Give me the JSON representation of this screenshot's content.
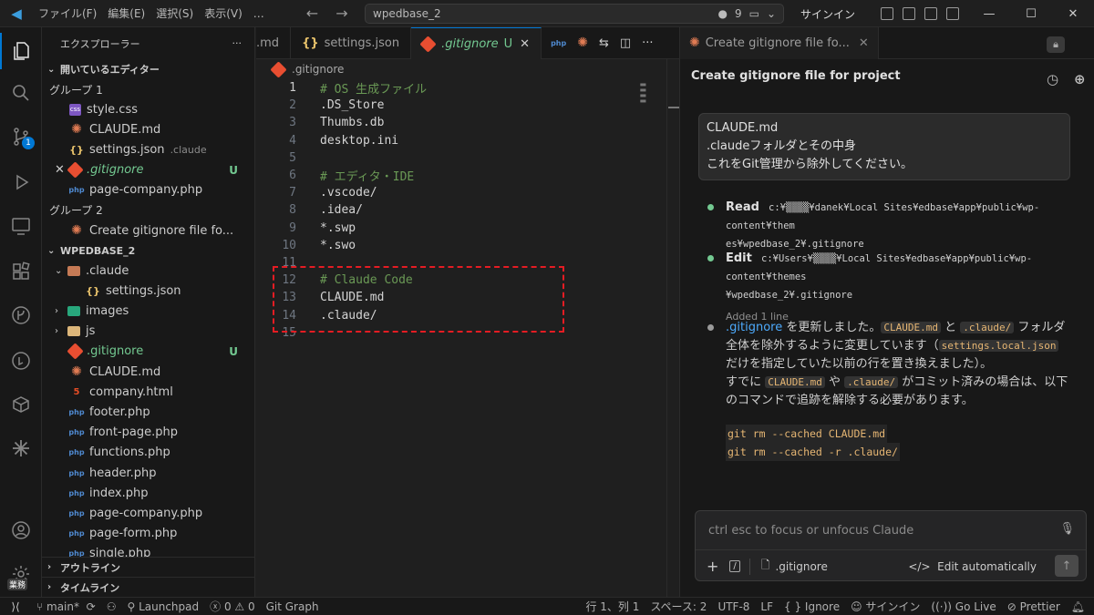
{
  "titlebar": {
    "menu": [
      "ファイル(F)",
      "編集(E)",
      "選択(S)",
      "表示(V)",
      "…"
    ],
    "search_text": "wpedbase_2",
    "count": "9",
    "signin": "サインイン"
  },
  "sidebar": {
    "title": "エクスプローラー",
    "open_editors_title": "開いているエディター",
    "group1_label": "グループ 1",
    "group2_label": "グループ 2",
    "open_editors": [
      {
        "name": "style.css"
      },
      {
        "name": "CLAUDE.md"
      },
      {
        "name": "settings.json",
        "desc": ".claude"
      },
      {
        "name": ".gitignore",
        "status": "U"
      },
      {
        "name": "page-company.php"
      }
    ],
    "group2_items": [
      {
        "name": "Create gitignore file fo..."
      }
    ],
    "project_title": "WPEDBASE_2",
    "tree": [
      {
        "name": ".claude"
      },
      {
        "name": "settings.json"
      },
      {
        "name": "images"
      },
      {
        "name": "js"
      },
      {
        "name": ".gitignore",
        "status": "U"
      },
      {
        "name": "CLAUDE.md"
      },
      {
        "name": "company.html"
      },
      {
        "name": "footer.php"
      },
      {
        "name": "front-page.php"
      },
      {
        "name": "functions.php"
      },
      {
        "name": "header.php"
      },
      {
        "name": "index.php"
      },
      {
        "name": "page-company.php"
      },
      {
        "name": "page-form.php"
      },
      {
        "name": "single.php"
      }
    ],
    "outline_title": "アウトライン",
    "timeline_title": "タイムライン",
    "activity_badge": "1",
    "account_badge": "業務"
  },
  "editor": {
    "tabs": [
      {
        "label": ".md"
      },
      {
        "label": "settings.json"
      },
      {
        "label": ".gitignore",
        "status": "U"
      }
    ],
    "breadcrumb": ".gitignore",
    "lines": [
      {
        "n": "1",
        "t": "# OS 生成ファイル",
        "comment": true
      },
      {
        "n": "2",
        "t": ".DS_Store"
      },
      {
        "n": "3",
        "t": "Thumbs.db"
      },
      {
        "n": "4",
        "t": "desktop.ini"
      },
      {
        "n": "5",
        "t": ""
      },
      {
        "n": "6",
        "t": "# エディタ・IDE",
        "comment": true
      },
      {
        "n": "7",
        "t": ".vscode/"
      },
      {
        "n": "8",
        "t": ".idea/"
      },
      {
        "n": "9",
        "t": "*.swp"
      },
      {
        "n": "10",
        "t": "*.swo"
      },
      {
        "n": "11",
        "t": ""
      },
      {
        "n": "12",
        "t": "# Claude Code",
        "comment": true
      },
      {
        "n": "13",
        "t": "CLAUDE.md"
      },
      {
        "n": "14",
        "t": ".claude/"
      },
      {
        "n": "15",
        "t": ""
      }
    ]
  },
  "panel": {
    "tab_title": "Create gitignore file fo...",
    "header": "Create gitignore file for project",
    "user_message": [
      "CLAUDE.md",
      ".claudeフォルダとその中身",
      "これをGit管理から除外してください。"
    ],
    "read_label": "Read",
    "read_path_1": "c:¥▒▒▒▒¥danek¥Local Sites¥edbase¥app¥public¥wp-content¥them",
    "read_path_2": "es¥wpedbase_2¥.gitignore",
    "edit_label": "Edit",
    "edit_path_1": "c:¥Users¥▒▒▒▒¥Local Sites¥edbase¥app¥public¥wp-content¥themes",
    "edit_path_2": "¥wpedbase_2¥.gitignore",
    "edit_sub": "Added 1 line",
    "response": {
      "link": ".gitignore",
      "t1": " を更新しました。",
      "c1": "CLAUDE.md",
      "t2": " と ",
      "c2": ".claude/",
      "t3": " フォルダ全体を除外するように変更しています（",
      "c3": "settings.local.json",
      "t4": " だけを指定していた以前の行を置き換えました）。",
      "t5": "すでに ",
      "c4": "CLAUDE.md",
      "t6": " や ",
      "c5": ".claude/",
      "t7": " がコミット済みの場合は、以下のコマンドで追跡を解除する必要があります。"
    },
    "commands": [
      "git rm --cached CLAUDE.md",
      "git rm --cached -r .claude/"
    ],
    "input_placeholder": "ctrl esc to focus or unfocus Claude",
    "input_file": ".gitignore",
    "edit_mode": "Edit automatically"
  },
  "status": {
    "branch": "main*",
    "launchpad": "Launchpad",
    "errors": "0",
    "warnings": "0",
    "git_graph": "Git Graph",
    "position": "行 1、列 1",
    "spaces": "スペース: 2",
    "encoding": "UTF-8",
    "eol": "LF",
    "language": "Ignore",
    "signin": "サインイン",
    "golive": "Go Live",
    "prettier": "Prettier"
  },
  "colors": {
    "accent": "#0078d4",
    "untracked": "#73c991",
    "highlight": "#e51c23",
    "link": "#4daafc"
  }
}
